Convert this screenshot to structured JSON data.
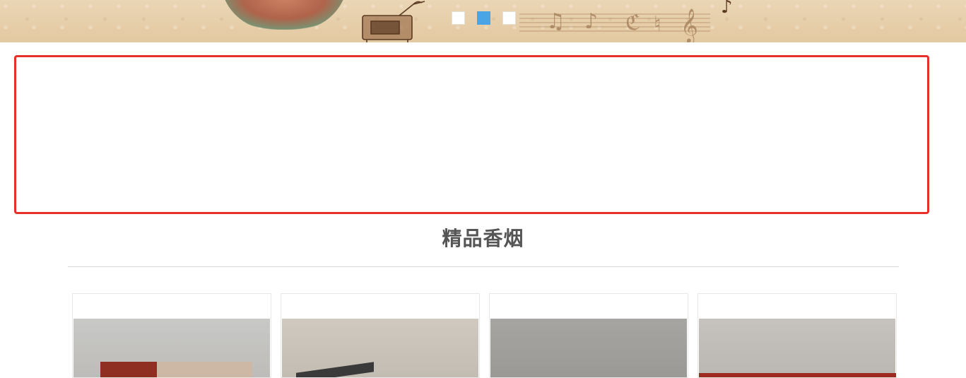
{
  "banner": {
    "slides": [
      {
        "label": "",
        "active": false
      },
      {
        "label": "",
        "active": true
      },
      {
        "label": "",
        "active": false
      }
    ],
    "colors": {
      "background": "#e6cfac",
      "dot_active": "#4aa5e6",
      "dot_inactive": "#ffffff"
    }
  },
  "highlight": {
    "border_color": "#e8302a"
  },
  "section": {
    "title": "精品香烟"
  },
  "products": [
    {
      "icon": "cigarette-pack-photo",
      "accent": "#8e2f22"
    },
    {
      "icon": "cigarette-pack-photo",
      "accent": "#3a3a3a"
    },
    {
      "icon": "cigarette-pack-photo",
      "accent": "#9b9995"
    },
    {
      "icon": "cigarette-pack-photo",
      "accent": "#9c2a20"
    }
  ]
}
